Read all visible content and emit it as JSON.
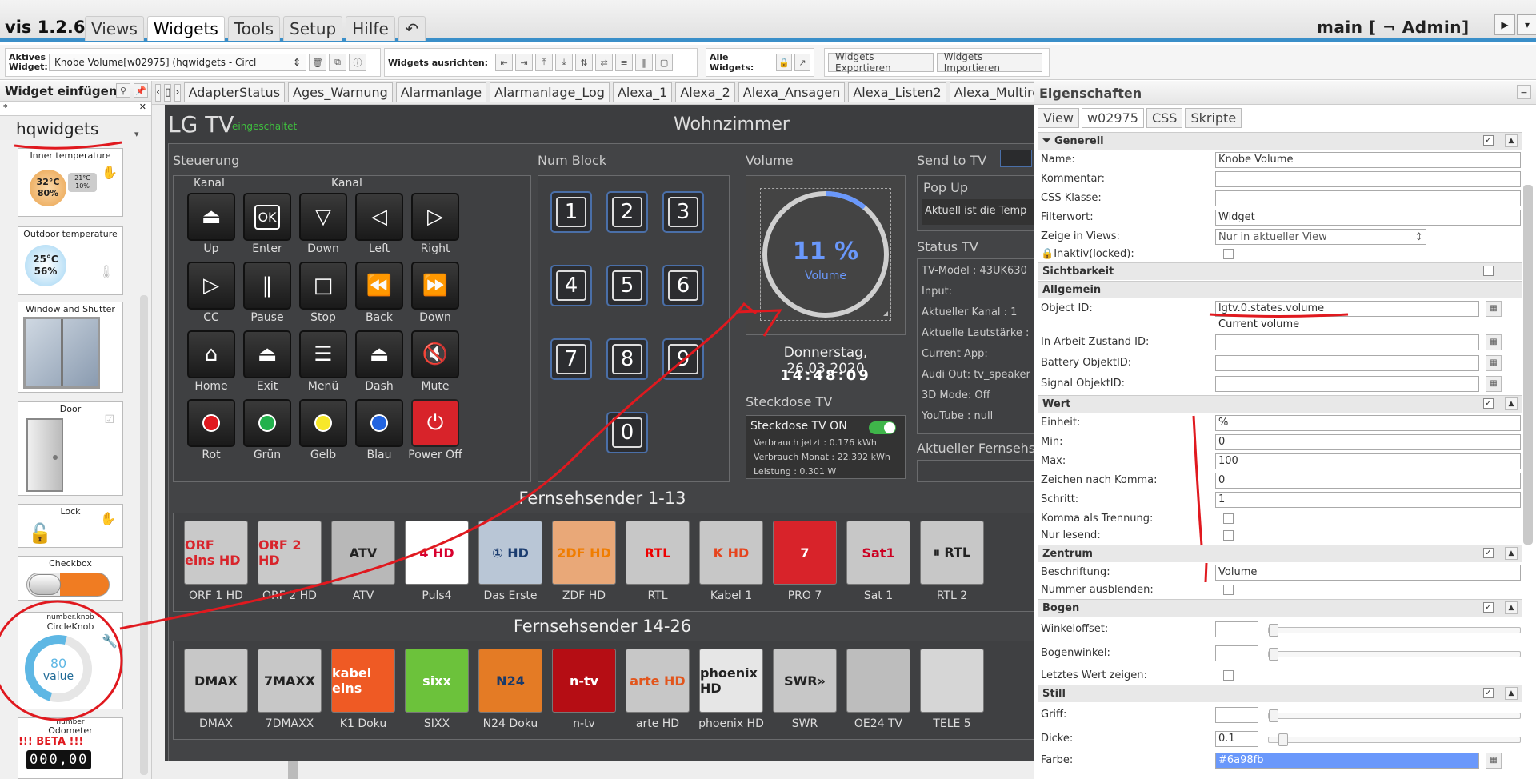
{
  "app": {
    "title": "vis 1.2.6",
    "menu": [
      "Views",
      "Widgets",
      "Tools",
      "Setup",
      "Hilfe"
    ],
    "undo_icon": "undo-arrow",
    "user": "main [ ¬ Admin]"
  },
  "toolbar": {
    "active_widget_label": "Aktives Widget:",
    "active_widget_value": "Knobe Volume[w02975] (hqwidgets - Circl",
    "align_label": "Widgets ausrichten:",
    "all_widgets_label": "Alle Widgets:",
    "export_label": "Widgets Exportieren",
    "import_label": "Widgets Importieren"
  },
  "left_panel": {
    "title": "Widget einfügen",
    "filter_value": "*",
    "widget_set": "hqwidgets",
    "widgets": [
      {
        "title": "Inner temperature",
        "temp": "32°C",
        "hum": "80%",
        "set1": "21°C",
        "set2": "10%"
      },
      {
        "title": "Outdoor temperature",
        "temp": "25°C",
        "hum": "56%"
      },
      {
        "title": "Window and Shutter"
      },
      {
        "title": "Door"
      },
      {
        "title": "Lock"
      },
      {
        "title": "Checkbox"
      },
      {
        "title1": "number.knob",
        "title2": "CircleKnob",
        "value": "80",
        "unit": "value"
      },
      {
        "title1": "number",
        "title2": "Odometer",
        "beta": "!!! BETA !!!",
        "digits": "000,00"
      }
    ]
  },
  "view_tabs": [
    "AdapterStatus",
    "Ages_Warnung",
    "Alarmanlage",
    "Alarmanlage_Log",
    "Alexa_1",
    "Alexa_2",
    "Alexa_Ansagen",
    "Alexa_Listen2",
    "Alexa_Multiroo"
  ],
  "view": {
    "title": "LG TV",
    "status": "eingeschaltet",
    "room": "Wohnzimmer",
    "steuerung": {
      "label": "Steuerung",
      "kanal1": "Kanal",
      "kanal2": "Kanal",
      "buttons": [
        {
          "label": "Up",
          "icon": "eject-up-icon"
        },
        {
          "label": "Enter",
          "icon": "ok-icon",
          "text": "OK"
        },
        {
          "label": "Down",
          "icon": "eject-down-icon"
        },
        {
          "label": "Left",
          "icon": "left-triangle-icon"
        },
        {
          "label": "Right",
          "icon": "right-triangle-icon"
        },
        {
          "label": "CC",
          "icon": "cc-icon"
        },
        {
          "label": "Pause",
          "icon": "pause-icon"
        },
        {
          "label": "Stop",
          "icon": "stop-icon"
        },
        {
          "label": "Back",
          "icon": "rewind-icon"
        },
        {
          "label": "Down",
          "icon": "forward-icon"
        },
        {
          "label": "Home",
          "icon": "home-icon"
        },
        {
          "label": "Exit",
          "icon": "eject-icon"
        },
        {
          "label": "Menü",
          "icon": "menu-icon"
        },
        {
          "label": "Dash",
          "icon": "eject-icon"
        },
        {
          "label": "Mute",
          "icon": "mute-icon"
        },
        {
          "label": "Rot",
          "icon": "red-dot-icon"
        },
        {
          "label": "Grün",
          "icon": "green-dot-icon"
        },
        {
          "label": "Gelb",
          "icon": "yellow-dot-icon"
        },
        {
          "label": "Blau",
          "icon": "blue-dot-icon"
        },
        {
          "label": "Power Off",
          "icon": "power-icon"
        }
      ]
    },
    "numblock": {
      "label": "Num Block",
      "keys": [
        "1",
        "2",
        "3",
        "4",
        "5",
        "6",
        "7",
        "8",
        "9",
        "0"
      ]
    },
    "volume": {
      "label": "Volume",
      "value_text": "11 %",
      "caption": "Volume",
      "fraction": 0.11,
      "date": "Donnerstag, 26.03.2020",
      "time": "14:48:09"
    },
    "send": {
      "label": "Send to TV",
      "popup_title": "Pop Up",
      "popup_text": "Aktuell ist die Temp"
    },
    "status_tv": {
      "label": "Status TV",
      "lines": [
        "TV-Model : 43UK630",
        "Input:",
        "Aktueller Kanal : 1",
        "Aktuelle Lautstärke :",
        "Current App:",
        "Audi Out: tv_speaker",
        "3D Mode: Off",
        "YouTube : null"
      ]
    },
    "steckdose": {
      "label": "Steckdose TV",
      "title": "Steckdose TV ON",
      "l1": "Verbrauch jetzt : 0.176 kWh",
      "l2": "Verbrauch Monat : 22.392 kWh",
      "l3": "Leistung : 0.301 W"
    },
    "fernseh_label": "Aktueller Fernsehse",
    "channels1": {
      "label": "Fernsehsender 1-13",
      "items": [
        {
          "name": "ORF 1 HD",
          "logo": "ORF eins HD",
          "bg": "#c9c9c9",
          "fg": "#d8242b"
        },
        {
          "name": "ORF 2 HD",
          "logo": "ORF 2 HD",
          "bg": "#c9c9c9",
          "fg": "#d8242b"
        },
        {
          "name": "ATV",
          "logo": "ATV",
          "bg": "#b8b8b8",
          "fg": "#222"
        },
        {
          "name": "Puls4",
          "logo": "4 HD",
          "bg": "#ffffff",
          "fg": "#d8002e"
        },
        {
          "name": "Das Erste",
          "logo": "① HD",
          "bg": "#b9c6d6",
          "fg": "#1c3d70"
        },
        {
          "name": "ZDF HD",
          "logo": "2DF HD",
          "bg": "#e9a878",
          "fg": "#f07d00"
        },
        {
          "name": "RTL",
          "logo": "RTL",
          "bg": "#c7c7c7",
          "fg": "#e00"
        },
        {
          "name": "Kabel 1",
          "logo": "K HD",
          "bg": "#c7c7c7",
          "fg": "#e6441d"
        },
        {
          "name": "PRO 7",
          "logo": "7",
          "bg": "#d8232a",
          "fg": "#fff"
        },
        {
          "name": "Sat 1",
          "logo": "Sat1",
          "bg": "#c7c7c7",
          "fg": "#c02"
        },
        {
          "name": "RTL 2",
          "logo": "⏸ RTL",
          "bg": "#c7c7c7",
          "fg": "#222"
        }
      ]
    },
    "channels2": {
      "label": "Fernsehsender 14-26",
      "items": [
        {
          "name": "DMAX",
          "logo": "DMAX",
          "bg": "#c7c7c7",
          "fg": "#222"
        },
        {
          "name": "7DMAXX",
          "logo": "7MAXX",
          "bg": "#c7c7c7",
          "fg": "#222"
        },
        {
          "name": "K1 Doku",
          "logo": "kabel eins",
          "bg": "#ef5a24",
          "fg": "#fff"
        },
        {
          "name": "SIXX",
          "logo": "sixx",
          "bg": "#6cc23b",
          "fg": "#fff"
        },
        {
          "name": "N24 Doku",
          "logo": "N24",
          "bg": "#e47b25",
          "fg": "#1a3a6a"
        },
        {
          "name": "n-tv",
          "logo": "n-tv",
          "bg": "#b50d14",
          "fg": "#fff"
        },
        {
          "name": "arte HD",
          "logo": "arte HD",
          "bg": "#c7c7c7",
          "fg": "#e2551c"
        },
        {
          "name": "phoenix HD",
          "logo": "phoenix HD",
          "bg": "#e6e6e6",
          "fg": "#222"
        },
        {
          "name": "SWR",
          "logo": "SWR»",
          "bg": "#c7c7c7",
          "fg": "#222"
        },
        {
          "name": "OE24 TV",
          "logo": "",
          "bg": "#bdbdbd",
          "fg": "#222"
        },
        {
          "name": "TELE 5",
          "logo": "",
          "bg": "#d6d6d6",
          "fg": "#222"
        }
      ]
    }
  },
  "props": {
    "title": "Eigenschaften",
    "tabs": [
      "View",
      "w02975",
      "CSS",
      "Skripte"
    ],
    "groups": {
      "generell": "Generell",
      "sichtbarkeit": "Sichtbarkeit",
      "allgemein": "Allgemein",
      "wert": "Wert",
      "zentrum": "Zentrum",
      "bogen": "Bogen",
      "still": "Still"
    },
    "fields": {
      "name_l": "Name:",
      "name_v": "Knobe Volume",
      "komm_l": "Kommentar:",
      "css_l": "CSS Klasse:",
      "filter_l": "Filterwort:",
      "filter_v": "Widget",
      "views_l": "Zeige in Views:",
      "views_v": "Nur in aktueller View",
      "locked_l": "Inaktiv(locked):",
      "oid_l": "Object ID:",
      "oid_v": "lgtv.0.states.volume",
      "oid_hint": "Current volume",
      "work_l": "In Arbeit Zustand ID:",
      "batt_l": "Battery ObjektID:",
      "sig_l": "Signal ObjektID:",
      "einheit_l": "Einheit:",
      "einheit_v": "%",
      "min_l": "Min:",
      "min_v": "0",
      "max_l": "Max:",
      "max_v": "100",
      "komma_l": "Zeichen nach Komma:",
      "komma_v": "0",
      "schritt_l": "Schritt:",
      "schritt_v": "1",
      "trenn_l": "Komma als Trennung:",
      "nurlesen_l": "Nur lesend:",
      "beschr_l": "Beschriftung:",
      "beschr_v": "Volume",
      "nummer_l": "Nummer ausblenden:",
      "winkel_l": "Winkeloffset:",
      "bogenw_l": "Bogenwinkel:",
      "letztes_l": "Letztes Wert zeigen:",
      "griff_l": "Griff:",
      "dicke_l": "Dicke:",
      "dicke_v": "0.1",
      "farbe_l": "Farbe:",
      "farbe_v": "#6a98fb"
    }
  },
  "colors": {
    "accent": "#3a8fc9",
    "knob": "#6a98fb",
    "annotation": "#e0191f"
  }
}
